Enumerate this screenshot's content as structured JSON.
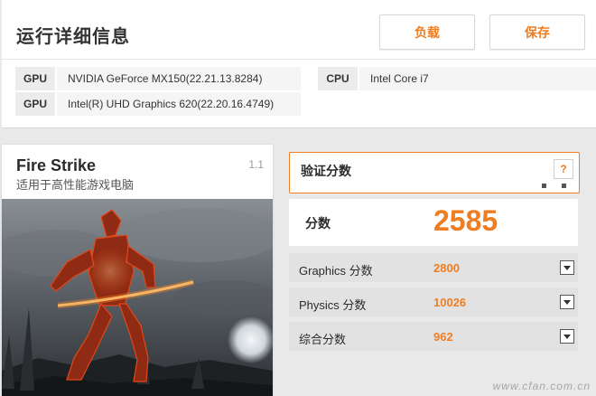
{
  "header": {
    "title": "运行详细信息",
    "load_label": "负载",
    "save_label": "保存"
  },
  "specs": {
    "gpu1_key": "GPU",
    "gpu1_value": "NVIDIA GeForce MX150(22.21.13.8284)",
    "gpu2_key": "GPU",
    "gpu2_value": "Intel(R) UHD Graphics 620(22.20.16.4749)",
    "cpu_key": "CPU",
    "cpu_value": "Intel Core i7"
  },
  "test": {
    "name": "Fire Strike",
    "subtitle": "适用于高性能游戏电脑",
    "version": "1.1"
  },
  "results": {
    "verify_label": "验证分数",
    "help_label": "?",
    "score_label": "分数",
    "score_value": "2585",
    "rows": [
      {
        "label": "Graphics 分数",
        "value": "2800"
      },
      {
        "label": "Physics 分数",
        "value": "10026"
      },
      {
        "label": "综合分数",
        "value": "962"
      }
    ]
  },
  "watermark": "www.cfan.com.cn",
  "colors": {
    "accent": "#ef7d22",
    "panel": "#ffffff",
    "background": "#e9e9e9"
  }
}
